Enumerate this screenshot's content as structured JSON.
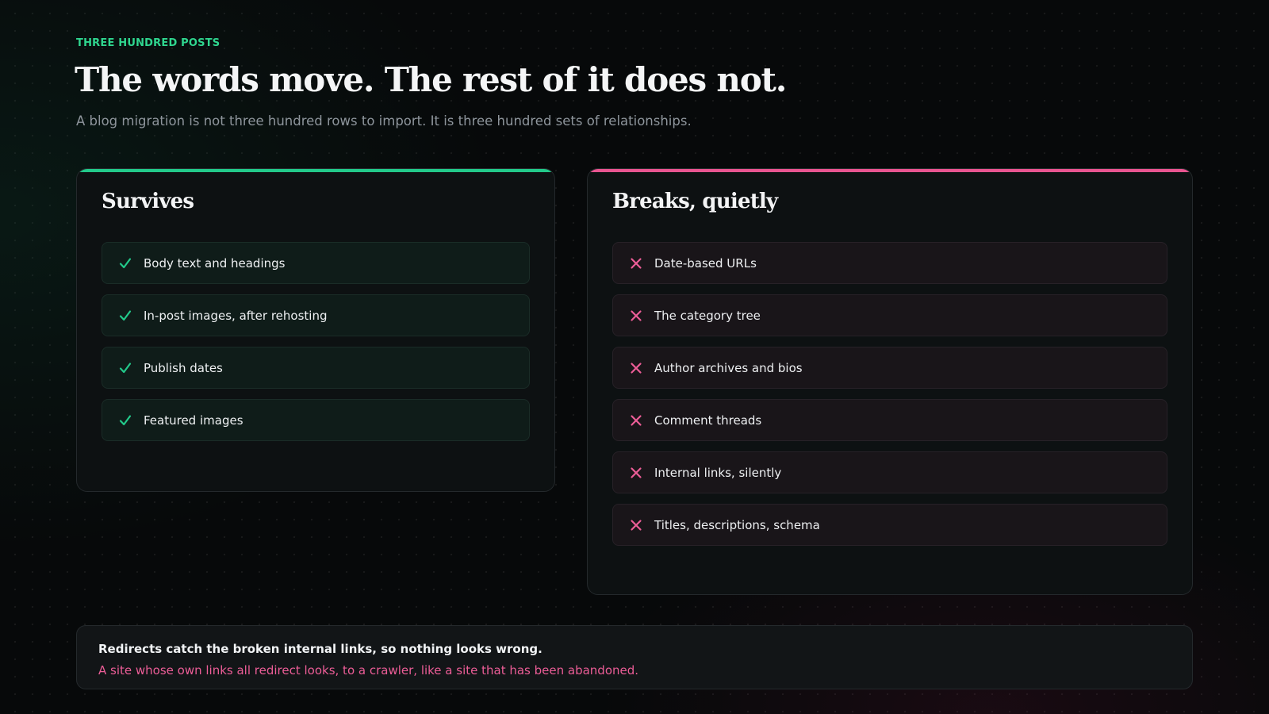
{
  "colors": {
    "accent_green": "#22c98a",
    "accent_pink": "#e85590",
    "background": "#07090a",
    "panel": "#0d1112"
  },
  "header": {
    "eyebrow": "THREE HUNDRED POSTS",
    "title": "The words move. The rest of it does not.",
    "subtitle": "A blog migration is not three hundred rows to import. It is three hundred sets of relationships."
  },
  "survives": {
    "title": "Survives",
    "icon": "check-icon",
    "items": [
      {
        "label": "Body text and headings"
      },
      {
        "label": "In-post images, after rehosting"
      },
      {
        "label": "Publish dates"
      },
      {
        "label": "Featured images"
      }
    ]
  },
  "breaks": {
    "title": "Breaks, quietly",
    "icon": "cross-icon",
    "items": [
      {
        "label": "Date-based URLs"
      },
      {
        "label": "The category tree"
      },
      {
        "label": "Author archives and bios"
      },
      {
        "label": "Comment threads"
      },
      {
        "label": "Internal links, silently"
      },
      {
        "label": "Titles, descriptions, schema"
      }
    ]
  },
  "footer": {
    "line1": "Redirects catch the broken internal links, so nothing looks wrong.",
    "line2": "A site whose own links all redirect looks, to a crawler, like a site that has been abandoned."
  }
}
